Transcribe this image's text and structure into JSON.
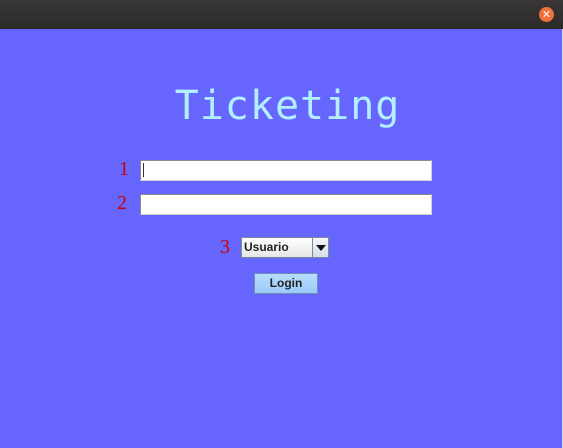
{
  "window": {
    "close_icon": "close-icon",
    "close_glyph": "✕"
  },
  "login_form": {
    "title": "Ticketing",
    "field1_marker": "1",
    "field2_marker": "2",
    "role_marker": "3",
    "username_value": "",
    "password_value": "",
    "role_selected": "Usuario",
    "login_button_label": "Login"
  },
  "colors": {
    "background": "#6666ff",
    "title_color": "#b3f0ff",
    "marker_color": "#cc0000",
    "button_color": "#9ccbf7"
  }
}
